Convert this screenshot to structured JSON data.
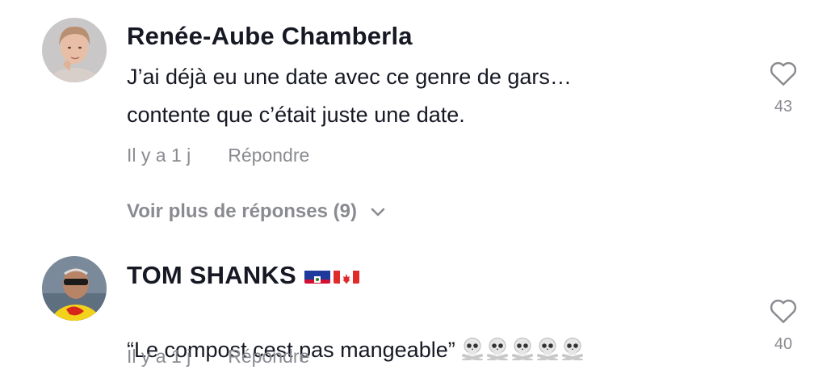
{
  "comments": [
    {
      "author": "Renée-Aube Chamberla",
      "text": "J’ai déjà eu une date avec ce genre de gars…\ncontente que c’était juste une date.",
      "time": "Il y a 1 j",
      "reply_label": "Répondre",
      "likes": "43",
      "more_replies_label": "Voir plus de réponses (9)"
    },
    {
      "author": "TOM SHANKS",
      "author_flags": [
        "haiti-flag",
        "canada-flag"
      ],
      "text": "“Le compost cest pas mangeable”",
      "emoji": [
        "skull-crossbones",
        "skull-crossbones",
        "skull-crossbones",
        "skull-crossbones",
        "skull-crossbones"
      ],
      "time": "Il y a 1 j",
      "reply_label": "Répondre",
      "likes": "40"
    }
  ],
  "icons": {
    "like": "heart-outline-icon",
    "expand": "chevron-down-icon"
  }
}
